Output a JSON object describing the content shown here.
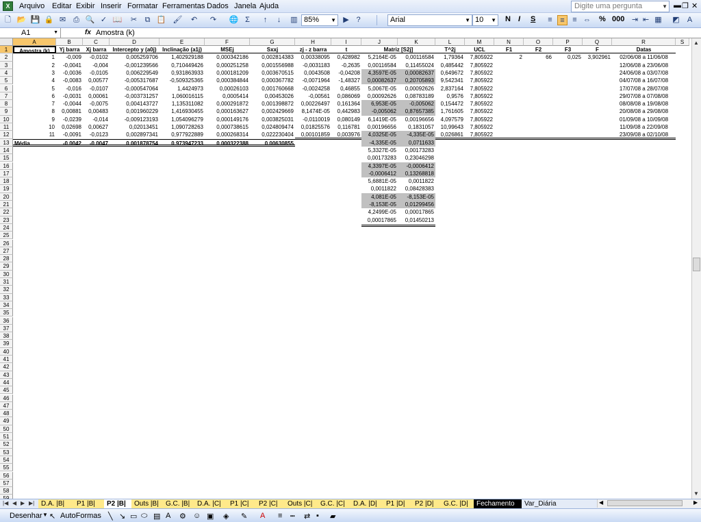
{
  "menu": [
    "Arquivo",
    "Editar",
    "Exibir",
    "Inserir",
    "Formatar",
    "Ferramentas",
    "Dados",
    "Janela",
    "Ajuda"
  ],
  "ask_placeholder": "Digite uma pergunta",
  "toolbar": {
    "zoom": "85%",
    "font": "Arial",
    "size": "10",
    "bold": "N",
    "italic": "I",
    "underline": "S",
    "percent": "%",
    "thousands": "000"
  },
  "name_box": "A1",
  "formula_content": "Amostra (k)",
  "columns": [
    "A",
    "B",
    "C",
    "D",
    "E",
    "F",
    "G",
    "H",
    "I",
    "J",
    "K",
    "L",
    "M",
    "N",
    "O",
    "P",
    "Q",
    "R",
    "S"
  ],
  "headers": {
    "A": "Amostra (k)",
    "B": "Yj barra",
    "C": "Xj barra",
    "D": "Intercepto y (a0j)",
    "E": "Inclinação (a1j)",
    "F": "MSEj",
    "G": "Sxxj",
    "H": "zj - z barra",
    "I": "t",
    "J": "Matriz [S2j]",
    "L": "T^2j",
    "M": "UCL",
    "N": "F1",
    "O": "F2",
    "P": "F3",
    "Q": "F",
    "R": "Datas"
  },
  "rows": [
    {
      "A": "1",
      "B": "-0,009",
      "C": "-0,0102",
      "D": "0,005259706",
      "E": "1,402929188",
      "F": "0,000342186",
      "G": "0,002814383",
      "H": "0,00338095",
      "I": "0,428982",
      "J": "5,2164E-05",
      "K": "0,00116584",
      "L": "1,79364",
      "M": "7,805922",
      "N": "2",
      "O": "66",
      "P": "0,025",
      "Q": "3,902961",
      "R": "02/06/08 a 11/06/08"
    },
    {
      "A": "2",
      "B": "-0,0041",
      "C": "-0,004",
      "D": "-0,001239566",
      "E": "0,710449426",
      "F": "0,000251258",
      "G": "0,001556988",
      "H": "-0,0031183",
      "I": "-0,2635",
      "J": "0,00116584",
      "K": "0,11455024",
      "L": "0,485442",
      "M": "7,805922",
      "R": "12/06/08 a 23/06/08"
    },
    {
      "A": "3",
      "B": "-0,0036",
      "C": "-0,0105",
      "D": "0,006229549",
      "E": "0,931863933",
      "F": "0,000181209",
      "G": "0,003670515",
      "H": "0,0043508",
      "I": "-0,04208",
      "J": "4,3597E-05",
      "K": "0,00082637",
      "L": "0,649672",
      "M": "7,805922",
      "R": "24/06/08 a 03/07/08"
    },
    {
      "A": "4",
      "B": "-0,0083",
      "C": "0,00577",
      "D": "-0,005317687",
      "E": "-0,509325365",
      "F": "0,000384844",
      "G": "0,000367782",
      "H": "-0,0071964",
      "I": "-1,48327",
      "J": "0,00082637",
      "K": "0,20705893",
      "L": "9,542341",
      "M": "7,805922",
      "R": "04/07/08 a 16/07/08"
    },
    {
      "A": "5",
      "B": "-0,016",
      "C": "-0,0107",
      "D": "-0,000547064",
      "E": "1,4424973",
      "F": "0,00026103",
      "G": "0,001760668",
      "H": "-0,0024258",
      "I": "0,46855",
      "J": "5,0067E-05",
      "K": "0,00092626",
      "L": "2,837164",
      "M": "7,805922",
      "R": "17/07/08 a 28/07/08"
    },
    {
      "A": "6",
      "B": "-0,0031",
      "C": "0,00061",
      "D": "-0,003731257",
      "E": "1,060016115",
      "F": "0,0005414",
      "G": "0,00453026",
      "H": "-0,00561",
      "I": "0,086069",
      "J": "0,00092626",
      "K": "0,08783189",
      "L": "0,9576",
      "M": "7,805922",
      "R": "29/07/08 a 07/08/08"
    },
    {
      "A": "7",
      "B": "-0,0044",
      "C": "-0,0075",
      "D": "0,004143727",
      "E": "1,135311082",
      "F": "0,000291872",
      "G": "0,001398872",
      "H": "0,00226497",
      "I": "0,161364",
      "J": "6,953E-05",
      "K": "-0,005062",
      "L": "0,154472",
      "M": "7,805922",
      "R": "08/08/08 a 19/08/08"
    },
    {
      "A": "8",
      "B": "0,00881",
      "C": "0,00483",
      "D": "0,001960229",
      "E": "1,416930455",
      "F": "0,000163627",
      "G": "0,002429669",
      "H": "8,1474E-05",
      "I": "0,442983",
      "J": "-0,005062",
      "K": "0,87657385",
      "L": "1,761605",
      "M": "7,805922",
      "R": "20/08/08 a 29/08/08"
    },
    {
      "A": "9",
      "B": "-0,0239",
      "C": "-0,014",
      "D": "-0,009123193",
      "E": "1,054096279",
      "F": "0,000149176",
      "G": "0,003825031",
      "H": "-0,0110019",
      "I": "0,080149",
      "J": "6,1419E-05",
      "K": "0,00196656",
      "L": "4,097579",
      "M": "7,805922",
      "R": "01/09/08 a 10/09/08"
    },
    {
      "A": "10",
      "B": "0,02698",
      "C": "0,00627",
      "D": "0,02013451",
      "E": "1,090728263",
      "F": "0,000738615",
      "G": "0,024809474",
      "H": "0,01825576",
      "I": "0,116781",
      "J": "0,00196656",
      "K": "0,1831057",
      "L": "10,99643",
      "M": "7,805922",
      "R": "11/09/08 a 22/09/08"
    },
    {
      "A": "11",
      "B": "-0,0091",
      "C": "-0,0123",
      "D": "0,002897341",
      "E": "0,977922889",
      "F": "0,000268314",
      "G": "0,022230404",
      "H": "0,00101859",
      "I": "0,003976",
      "J": "4,0325E-05",
      "K": "-4,335E-05",
      "L": "0,026861",
      "M": "7,805922",
      "R": "23/09/08 a 02/10/08"
    },
    {
      "A": "Média",
      "B": "-0,0042",
      "C": "-0,0047",
      "D": "0,001878754",
      "E": "0,973947233",
      "F": "0,000322388",
      "G": "0,00630855",
      "J": "-4,335E-05",
      "K": "0,0711633"
    }
  ],
  "matrix_extra": [
    {
      "J": "5,3327E-05",
      "K": "0,00173283"
    },
    {
      "J": "0,00173283",
      "K": "0,23046298"
    },
    {
      "J": "4,3397E-05",
      "K": "-0,0006412"
    },
    {
      "J": "-0,0006412",
      "K": "0,13268818"
    },
    {
      "J": "5,6881E-05",
      "K": "0,0011822"
    },
    {
      "J": "0,0011822",
      "K": "0,08428383"
    },
    {
      "J": "4,081E-05",
      "K": "-8,153E-05"
    },
    {
      "J": "-8,153E-05",
      "K": "0,01299456"
    },
    {
      "J": "4,2499E-05",
      "K": "0,00017865"
    },
    {
      "J": "0,00017865",
      "K": "0,01450213"
    }
  ],
  "row_numbers": [
    "1",
    "2",
    "3",
    "4",
    "5",
    "6",
    "7",
    "8",
    "9",
    "10",
    "11",
    "12",
    "13",
    "14",
    "15",
    "16",
    "17",
    "18",
    "19",
    "20",
    "21",
    "22",
    "23",
    "24",
    "25",
    "26",
    "27",
    "28",
    "29",
    "30",
    "31",
    "32",
    "33",
    "34",
    "35",
    "36",
    "37",
    "38",
    "39",
    "40",
    "41",
    "42",
    "43",
    "44",
    "45",
    "46",
    "47",
    "48",
    "49",
    "50",
    "51",
    "52",
    "53",
    "54",
    "55",
    "56",
    "57",
    "58",
    "59"
  ],
  "sheet_tabs": [
    {
      "label": "D.A. |B|",
      "style": "yellow"
    },
    {
      "label": "P1 |B|",
      "style": "yellow"
    },
    {
      "label": "P2 |B|",
      "style": "active"
    },
    {
      "label": "Outs |B|",
      "style": "yellow"
    },
    {
      "label": "G.C. |B|",
      "style": "yellow"
    },
    {
      "label": "D.A. |C|",
      "style": "yellow"
    },
    {
      "label": "P1 |C|",
      "style": "yellow"
    },
    {
      "label": "P2 |C|",
      "style": "yellow"
    },
    {
      "label": "Outs |C|",
      "style": "yellow"
    },
    {
      "label": "G.C. |C|",
      "style": "yellow"
    },
    {
      "label": "D.A. |D|",
      "style": "yellow"
    },
    {
      "label": "P1 |D|",
      "style": "yellow"
    },
    {
      "label": "P2 |D|",
      "style": "yellow"
    },
    {
      "label": "G.C. |D|",
      "style": "yellow"
    },
    {
      "label": "Fechamento",
      "style": "black"
    },
    {
      "label": "Var_Diária",
      "style": "normal"
    }
  ],
  "draw_toolbar": {
    "draw": "Desenhar",
    "autoshapes": "AutoFormas"
  }
}
